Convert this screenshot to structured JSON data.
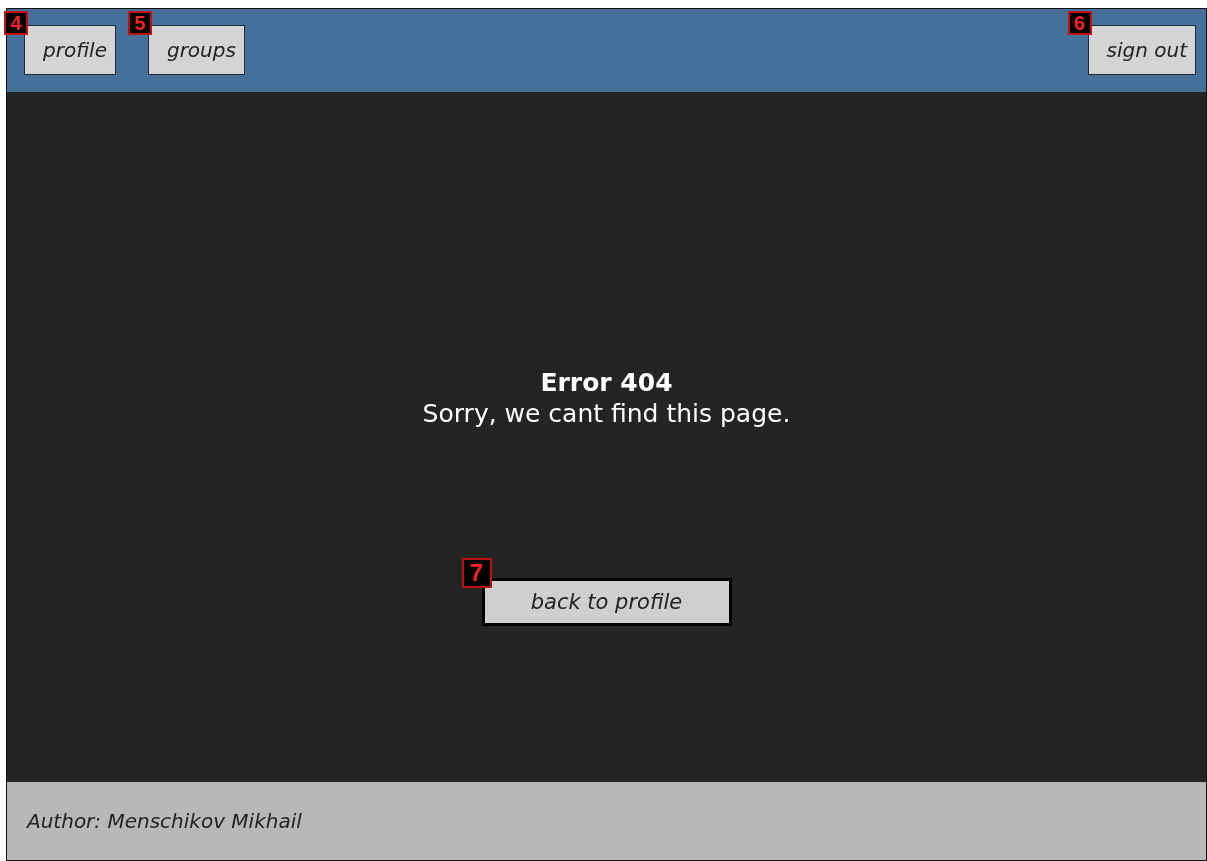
{
  "header": {
    "left_buttons": [
      {
        "label": "profile",
        "marker": "4"
      },
      {
        "label": "groups",
        "marker": "5"
      }
    ],
    "right_button": {
      "label": "sign out",
      "marker": "6"
    }
  },
  "error": {
    "title": "Error 404",
    "message": "Sorry, we cant find this page."
  },
  "back_button": {
    "label": "back to profile",
    "marker": "7"
  },
  "footer": {
    "text": "Author: Menschikov Mikhail"
  }
}
